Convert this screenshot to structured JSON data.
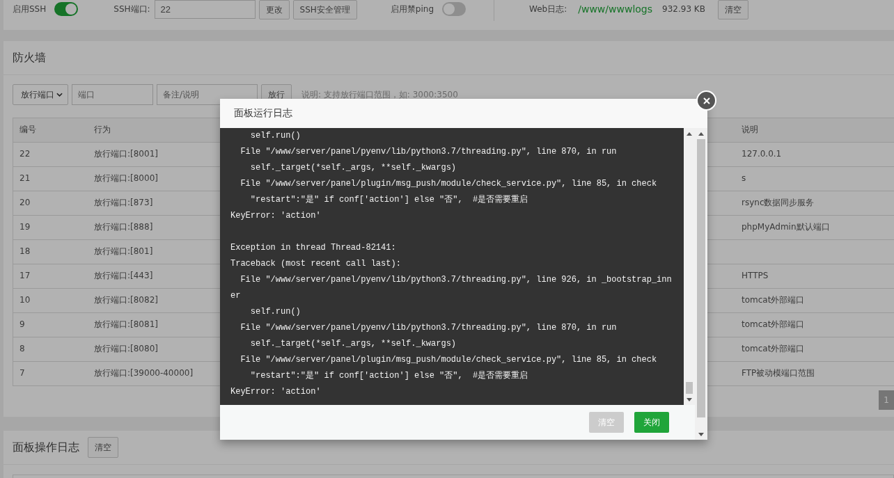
{
  "top_bar": {
    "items": [
      {
        "kind": "toggle",
        "label": "启用SSH",
        "on": true
      },
      {
        "kind": "field",
        "label": "SSH端口:",
        "value": "22"
      },
      {
        "kind": "button",
        "label": "更改"
      },
      {
        "kind": "button",
        "label": "SSH安全管理"
      },
      {
        "kind": "toggle",
        "label": "启用禁ping",
        "on": false
      },
      {
        "kind": "divider"
      },
      {
        "kind": "link",
        "label": "Web日志:",
        "value": "/www/wwwlogs"
      },
      {
        "kind": "text",
        "label": "932.93 KB"
      },
      {
        "kind": "button",
        "label": "清空"
      }
    ]
  },
  "firewall": {
    "title": "防火墙",
    "toolbar": {
      "select": "放行端口",
      "port_placeholder": "端口",
      "note_placeholder": "备注/说明",
      "button": "放行",
      "hint": "说明: 支持放行端口范围，如: 3000:3500"
    },
    "table": {
      "columns": [
        "编号",
        "行为",
        "说明"
      ],
      "rows": [
        {
          "number": "22",
          "action": "放行端口:[8001]",
          "note": "127.0.0.1"
        },
        {
          "number": "21",
          "action": "放行端口:[8000]",
          "note": "s"
        },
        {
          "number": "20",
          "action": "放行端口:[873]",
          "note": "rsync数据同步服务"
        },
        {
          "number": "19",
          "action": "放行端口:[888]",
          "note": "phpMyAdmin默认端口"
        },
        {
          "number": "18",
          "action": "放行端口:[801]"
        },
        {
          "number": "17",
          "action": "放行端口:[443]",
          "note": "HTTPS"
        },
        {
          "number": "10",
          "action": "放行端口:[8082]",
          "note": "tomcat外部端口"
        },
        {
          "number": "9",
          "action": "放行端口:[8081]",
          "note": "tomcat外部端口"
        },
        {
          "number": "8",
          "action": "放行端口:[8080]",
          "note": "tomcat外部端口"
        },
        {
          "number": "7",
          "action": "放行端口:[39000-40000]",
          "note": "FTP被动模端口范围"
        }
      ]
    },
    "pagination": {
      "pages": [
        {
          "label": "1",
          "selected": true
        }
      ]
    }
  },
  "operation_log": {
    "title": "面板操作日志",
    "button": "清空"
  },
  "dialog": {
    "title": "面板运行日志",
    "log": [
      {
        "lines": [
          "    self.run()",
          "  File \"/www/server/panel/pyenv/lib/python3.7/threading.py\", line 870, in run",
          "    self._target(*self._args, **self._kwargs)",
          "  File \"/www/server/panel/plugin/msg_push/module/check_service.py\", line 85, in check",
          "    \"restart\":\"是\" if conf['action'] else \"否\",  #是否需要重启",
          "KeyError: 'action'"
        ]
      },
      {
        "lines": [
          "Exception in thread Thread-82141:",
          "Traceback (most recent call last):",
          "  File \"/www/server/panel/pyenv/lib/python3.7/threading.py\", line 926, in _bootstrap_inner",
          "    self.run()",
          "  File \"/www/server/panel/pyenv/lib/python3.7/threading.py\", line 870, in run",
          "    self._target(*self._args, **self._kwargs)",
          "  File \"/www/server/panel/plugin/msg_push/module/check_service.py\", line 85, in check",
          "    \"restart\":\"是\" if conf['action'] else \"否\",  #是否需要重启",
          "KeyError: 'action'"
        ]
      }
    ],
    "buttons": [
      {
        "label": "清空",
        "kind": "secondary",
        "disabled": true
      },
      {
        "label": "关闭",
        "kind": "primary",
        "disabled": false
      }
    ]
  }
}
